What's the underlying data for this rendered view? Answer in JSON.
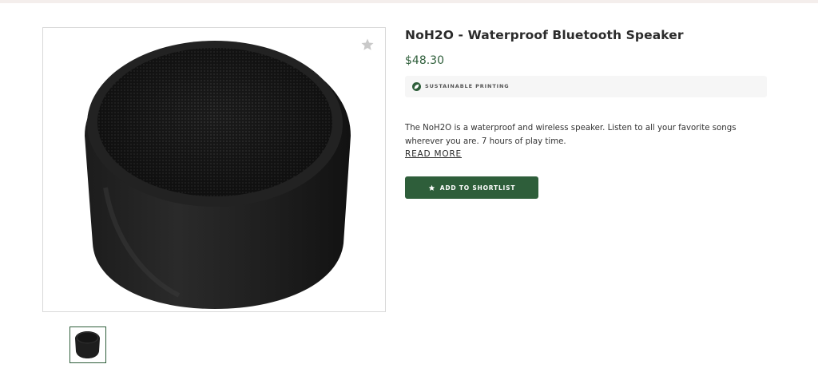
{
  "product": {
    "title": "NoH2O - Waterproof Bluetooth Speaker",
    "price": "$48.30",
    "badge_icon": "leaf-icon",
    "badge_text": "SUSTAINABLE PRINTING",
    "description": "The NoH2O is a waterproof and wireless speaker.  Listen to all your favorite songs wherever you are. 7 hours of play time.",
    "read_more_label": "READ MORE",
    "shortlist_button_label": "ADD TO SHORTLIST",
    "shortlist_icon": "star-icon",
    "favorite_icon": "star-icon"
  },
  "colors": {
    "accent": "#2e5e3a",
    "badge_bg": "#f6f6f6",
    "top_strip": "#f4eeec"
  }
}
